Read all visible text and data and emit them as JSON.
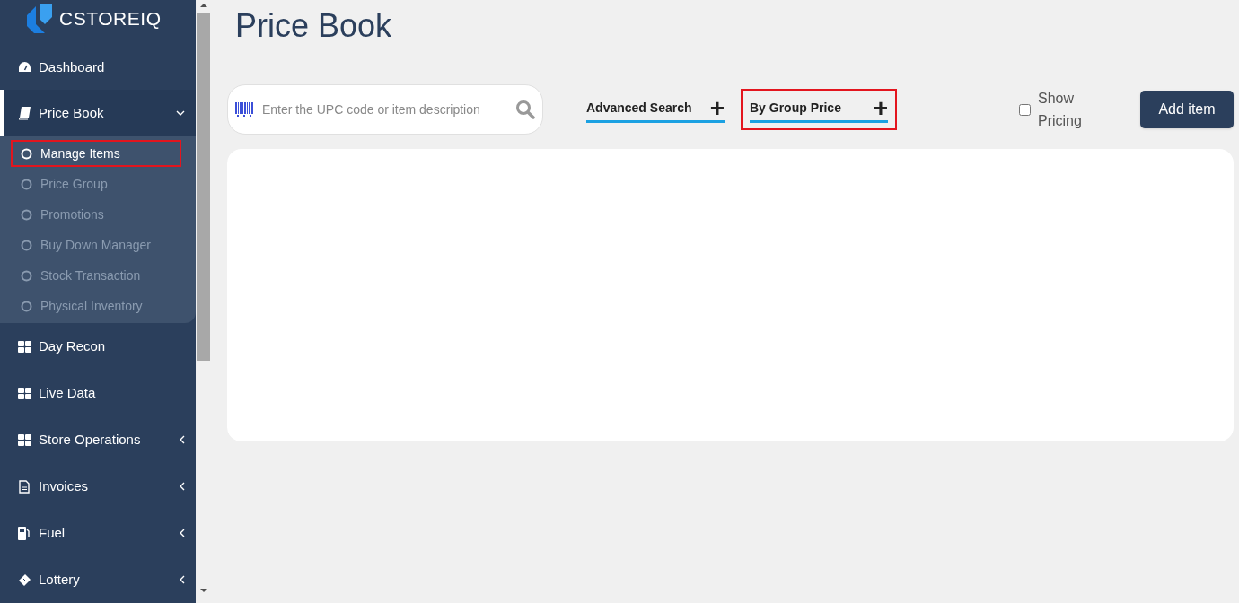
{
  "logo": {
    "text": "CSTOREIQ"
  },
  "sidebar": {
    "items": [
      {
        "label": "Dashboard",
        "selected": false,
        "kind": "link"
      },
      {
        "label": "Price Book",
        "selected": true,
        "kind": "expanded",
        "children": [
          {
            "label": "Manage Items",
            "selected": true,
            "highlighted": true
          },
          {
            "label": "Price Group",
            "selected": false,
            "highlighted": false
          },
          {
            "label": "Promotions",
            "selected": false,
            "highlighted": false
          },
          {
            "label": "Buy Down Manager",
            "selected": false,
            "highlighted": false
          },
          {
            "label": "Stock Transaction",
            "selected": false,
            "highlighted": false
          },
          {
            "label": "Physical Inventory",
            "selected": false,
            "highlighted": false
          }
        ]
      },
      {
        "label": "Day Recon",
        "selected": false,
        "kind": "link"
      },
      {
        "label": "Live Data",
        "selected": false,
        "kind": "link"
      },
      {
        "label": "Store Operations",
        "selected": false,
        "kind": "collapsed"
      },
      {
        "label": "Invoices",
        "selected": false,
        "kind": "collapsed"
      },
      {
        "label": "Fuel",
        "selected": false,
        "kind": "collapsed"
      },
      {
        "label": "Lottery",
        "selected": false,
        "kind": "collapsed"
      }
    ]
  },
  "page_title": "Price Book",
  "search": {
    "placeholder": "Enter the UPC code or item description"
  },
  "filters": [
    {
      "label": "Advanced Search",
      "icon_text": "+",
      "highlighted": false
    },
    {
      "label": "By Group Price",
      "icon_text": "+",
      "highlighted": true
    }
  ],
  "show_pricing": {
    "label": "Show Pricing",
    "checked": false
  },
  "add_button": "Add item"
}
